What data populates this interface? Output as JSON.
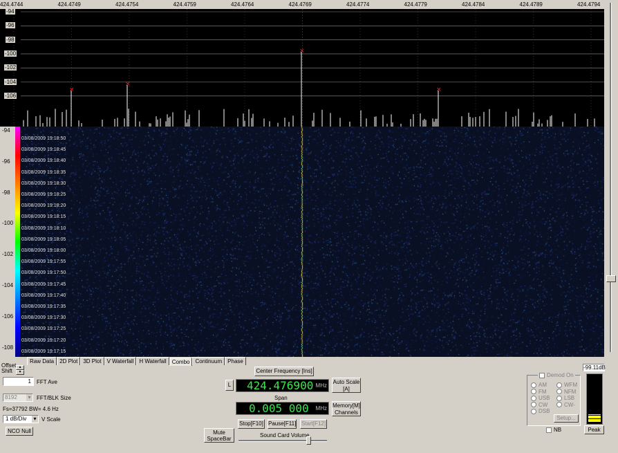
{
  "frequency_axis": {
    "ticks": [
      "424.4744",
      "424.4749",
      "424.4754",
      "424.4759",
      "424.4764",
      "424.4769",
      "424.4774",
      "424.4779",
      "424.4784",
      "424.4789",
      "424.4794"
    ]
  },
  "spectrum_axis": {
    "ticks": [
      "-94",
      "-96",
      "-98",
      "-100",
      "-102",
      "-104",
      "-106"
    ]
  },
  "waterfall_axis": {
    "ticks": [
      "-94",
      "-96",
      "-98",
      "-100",
      "-102",
      "-104",
      "-106",
      "-108"
    ]
  },
  "waterfall_timestamps": [
    "03/08/2009 19:18:50",
    "03/08/2009 19:18:45",
    "03/08/2009 19:18:40",
    "03/08/2009 19:18:35",
    "03/08/2009 19:18:30",
    "03/08/2009 19:18:25",
    "03/08/2009 19:18:20",
    "03/08/2009 19:18:15",
    "03/08/2009 19:18:10",
    "03/08/2009 19:18:05",
    "03/08/2009 19:18:00",
    "03/08/2009 19:17:55",
    "03/08/2009 19:17:50",
    "03/08/2009 19:17:45",
    "03/08/2009 19:17:40",
    "03/08/2009 19:17:35",
    "03/08/2009 19:17:30",
    "03/08/2009 19:17:25",
    "03/08/2009 19:17:20",
    "03/08/2009 19:17:15"
  ],
  "tabs": [
    "Raw Data",
    "2D Plot",
    "3D Plot",
    "V Waterfall",
    "H Waterfall",
    "Combo",
    "Continuum",
    "Phase"
  ],
  "active_tab": "Combo",
  "offset_shift_label": "Offset Shift",
  "fft_ave": {
    "value": "1",
    "label": "FFT Ave"
  },
  "fft_blk": {
    "value": "8192",
    "label": "FFT/BLK Size"
  },
  "fs_info": "Fs=37792 BW= 4.6 Hz",
  "vscale": {
    "value": "1 dB/Div",
    "label": "V Scale"
  },
  "nco_null_label": "NCO Null",
  "center_frequency": {
    "button": "Center Frequency [Ins]",
    "l_button": "L",
    "value": "424.476900",
    "unit": "MHz"
  },
  "auto_scale_label": "Auto Scale [A]",
  "span": {
    "label": "Span",
    "value": "0.005 000",
    "unit": "MHz"
  },
  "memory_label": "Memory[M] Channels",
  "stop_label": "Stop[F10]",
  "pause_label": "Pause[F11]",
  "start_label": "Start[F12]",
  "mute_label": "Mute SpaceBar",
  "sound_volume_label": "Sound Card Volume",
  "demod": {
    "label": "Demod On",
    "modes_left": [
      "AM",
      "FM",
      "USB",
      "CW",
      "DSB"
    ],
    "modes_right": [
      "WFM",
      "NFM",
      "LSB",
      "CW-"
    ],
    "setup_label": "Setup..."
  },
  "nb_label": "NB",
  "level": {
    "value": "-99.11dB",
    "peak_label": "Peak",
    "fill_fraction": 0.18
  },
  "colors": {
    "spectrum_bg": "#000000",
    "trace": "#ffffff",
    "peak_marker": "#ff2020",
    "waterfall_bg": "#0a1024",
    "lcd_text": "#39e84a",
    "meter_fill": "#ffff00"
  }
}
